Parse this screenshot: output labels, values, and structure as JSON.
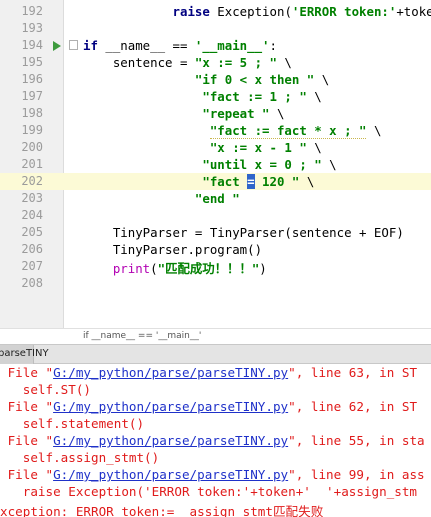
{
  "editor": {
    "lines": [
      {
        "num": "192",
        "indent": "            ",
        "parts": [
          {
            "t": "raise",
            "c": "kw"
          },
          {
            "t": " Exception(",
            "c": ""
          },
          {
            "t": "'ERROR token:'",
            "c": "str"
          },
          {
            "t": "+token+",
            "c": ""
          }
        ]
      },
      {
        "num": "193",
        "indent": "",
        "parts": []
      },
      {
        "num": "194",
        "indent": "",
        "parts": [
          {
            "t": "if",
            "c": "kw"
          },
          {
            "t": " __name__ == ",
            "c": ""
          },
          {
            "t": "'__main__'",
            "c": "str"
          },
          {
            "t": ":",
            "c": ""
          }
        ]
      },
      {
        "num": "195",
        "indent": "    ",
        "parts": [
          {
            "t": "sentence = ",
            "c": ""
          },
          {
            "t": "\"x := 5 ; \"",
            "c": "str"
          },
          {
            "t": " \\",
            "c": ""
          }
        ]
      },
      {
        "num": "196",
        "indent": "               ",
        "parts": [
          {
            "t": "\"if 0 < x then \"",
            "c": "str"
          },
          {
            "t": " \\",
            "c": ""
          }
        ]
      },
      {
        "num": "197",
        "indent": "                ",
        "parts": [
          {
            "t": "\"fact := 1 ; \"",
            "c": "str"
          },
          {
            "t": " \\",
            "c": ""
          }
        ]
      },
      {
        "num": "198",
        "indent": "                ",
        "parts": [
          {
            "t": "\"repeat \"",
            "c": "str"
          },
          {
            "t": " \\",
            "c": ""
          }
        ]
      },
      {
        "num": "199",
        "indent": "                 ",
        "parts": [
          {
            "t": "\"fact := fact * x ; \"",
            "c": "str"
          },
          {
            "t": " \\",
            "c": ""
          }
        ]
      },
      {
        "num": "200",
        "indent": "                 ",
        "parts": [
          {
            "t": "\"x := x - 1 \"",
            "c": "str"
          },
          {
            "t": " \\",
            "c": ""
          }
        ]
      },
      {
        "num": "201",
        "indent": "                ",
        "parts": [
          {
            "t": "\"until x = 0 ; \"",
            "c": "str"
          },
          {
            "t": " \\",
            "c": ""
          }
        ]
      },
      {
        "num": "202",
        "indent": "                ",
        "parts": [
          {
            "t": "\"fact ",
            "c": "str"
          },
          {
            "t": "=",
            "c": "str sel"
          },
          {
            "t": " 120 \"",
            "c": "str"
          },
          {
            "t": " \\",
            "c": ""
          }
        ]
      },
      {
        "num": "203",
        "indent": "               ",
        "parts": [
          {
            "t": "\"end \"",
            "c": "str"
          }
        ]
      },
      {
        "num": "204",
        "indent": "",
        "parts": []
      },
      {
        "num": "205",
        "indent": "    ",
        "parts": [
          {
            "t": "TinyParser = TinyParser(sentence + EOF)",
            "c": ""
          }
        ]
      },
      {
        "num": "206",
        "indent": "    ",
        "parts": [
          {
            "t": "TinyParser.program()",
            "c": ""
          }
        ]
      },
      {
        "num": "207",
        "indent": "    ",
        "parts": [
          {
            "t": "print",
            "c": "mag"
          },
          {
            "t": "(",
            "c": ""
          },
          {
            "t": "\"匹配成功！！！\"",
            "c": "str"
          },
          {
            "t": ")",
            "c": ""
          }
        ]
      },
      {
        "num": "208",
        "indent": "",
        "parts": []
      }
    ],
    "breadcrumb": "if __name__ == '__main__'"
  },
  "run_tab": {
    "label": "parseTINY"
  },
  "console": {
    "lines": [
      {
        "pre": " File \"",
        "link": "G:/my_python/parse/parseTINY.py",
        "post": "\", line 63, in ST"
      },
      {
        "pre": "   self.ST()",
        "link": "",
        "post": ""
      },
      {
        "pre": " File \"",
        "link": "G:/my_python/parse/parseTINY.py",
        "post": "\", line 62, in ST"
      },
      {
        "pre": "   self.statement()",
        "link": "",
        "post": ""
      },
      {
        "pre": " File \"",
        "link": "G:/my_python/parse/parseTINY.py",
        "post": "\", line 55, in sta"
      },
      {
        "pre": "   self.assign_stmt()",
        "link": "",
        "post": ""
      },
      {
        "pre": " File \"",
        "link": "G:/my_python/parse/parseTINY.py",
        "post": "\", line 99, in ass"
      },
      {
        "pre": "   raise Exception('ERROR token:'+token+'  '+assign_stm",
        "link": "",
        "post": ""
      },
      {
        "pre": "xception: ERROR token:=  assign_stmt匹配失败",
        "link": "",
        "post": ""
      }
    ]
  },
  "colors": {
    "keyword": "#000080",
    "string": "#008000",
    "error": "#e01b1b",
    "link": "#1f31c9",
    "caret_line": "#fcfad6"
  }
}
